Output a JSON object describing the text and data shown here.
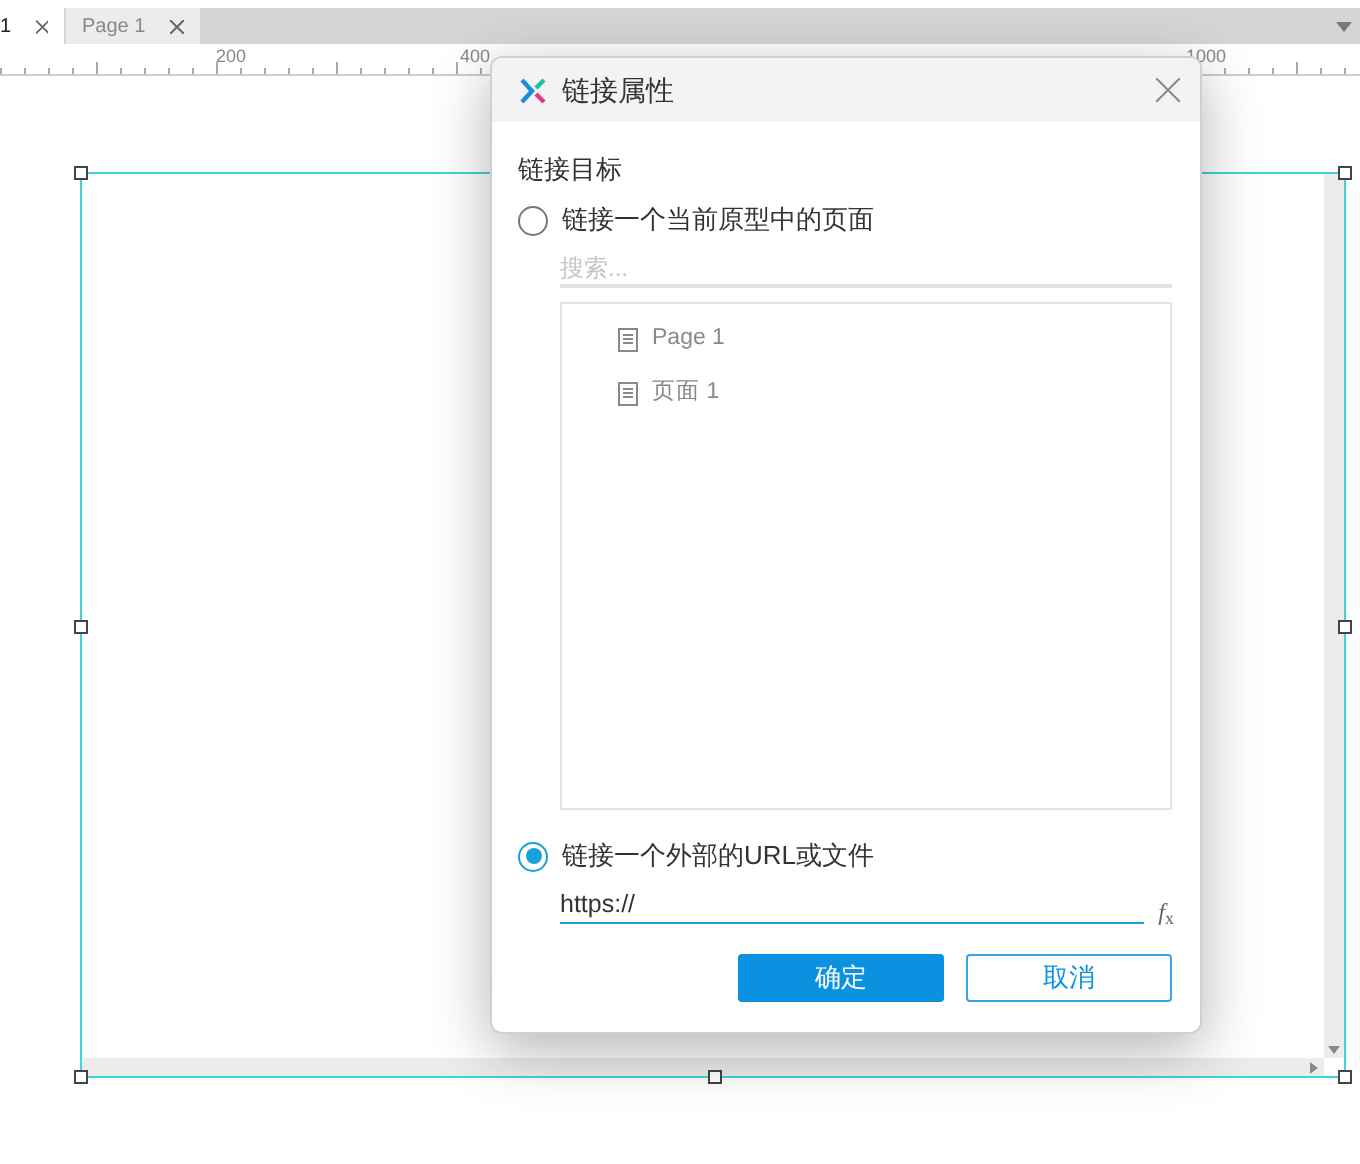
{
  "tabs": [
    {
      "label": "1",
      "selected": true
    },
    {
      "label": "Page 1",
      "selected": false
    }
  ],
  "ruler": {
    "labels": [
      "200",
      "400",
      "1000"
    ]
  },
  "dialog": {
    "title": "链接属性",
    "section_label": "链接目标",
    "options": [
      {
        "label": "链接一个当前原型中的页面",
        "selected": false
      },
      {
        "label": "链接一个外部的URL或文件",
        "selected": true
      }
    ],
    "search": {
      "placeholder": "搜索..."
    },
    "pages": [
      {
        "label": "Page 1"
      },
      {
        "label": "页面 1"
      }
    ],
    "url": {
      "value": "https://"
    },
    "fx": "*f*$_{x}$",
    "buttons": [
      {
        "label": "确定",
        "kind": "primary"
      },
      {
        "label": "取消",
        "kind": "secondary"
      }
    ]
  }
}
